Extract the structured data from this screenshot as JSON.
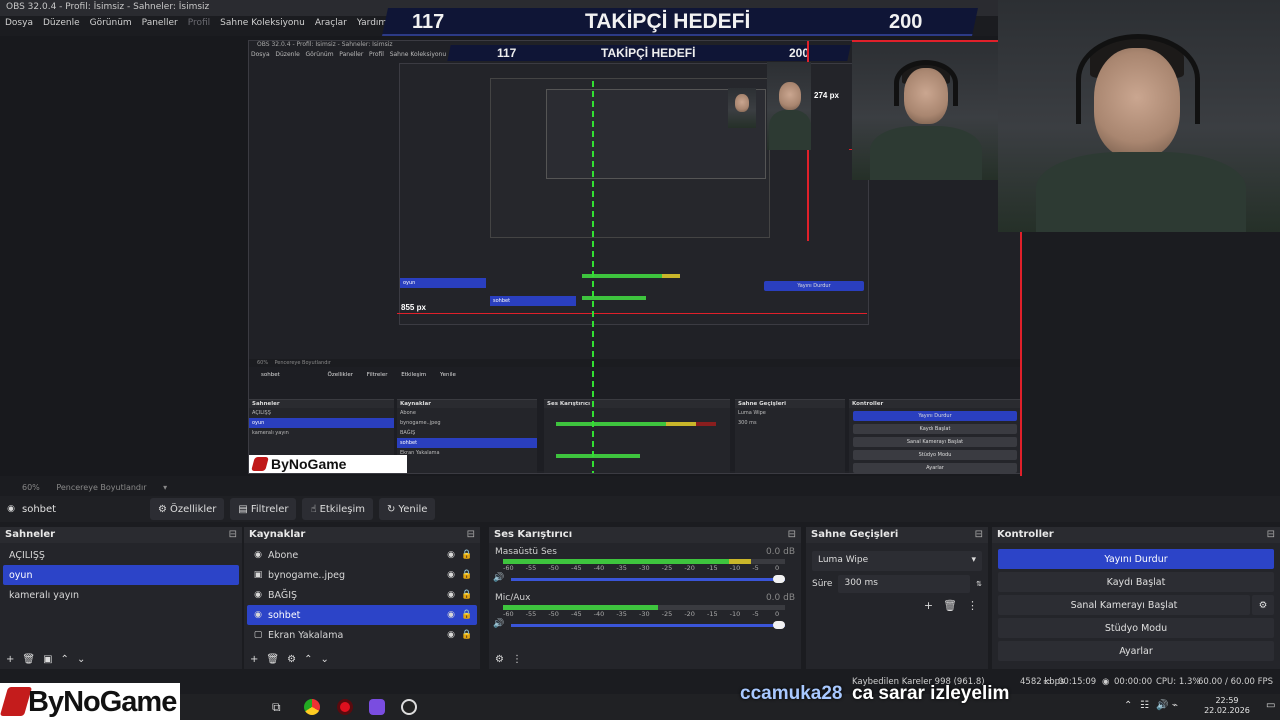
{
  "window": {
    "title": "OBS 32.0.4 - Profil: İsimsiz - Sahneler: İsimsiz"
  },
  "menu": [
    "Dosya",
    "Düzenle",
    "Görünüm",
    "Paneller",
    "Profil",
    "Sahne Koleksiyonu",
    "Araçlar",
    "Yardım"
  ],
  "goal_banner": {
    "current": "117",
    "title": "TAKİPÇİ HEDEFİ",
    "goal": "200"
  },
  "nested_preview": {
    "px_label_1": "274 px",
    "px_label_2": "855 px",
    "src_name": "sohbet",
    "btns": [
      "Özellikler",
      "Filtreler",
      "Etkileşim",
      "Yenile"
    ]
  },
  "zoom_bar": {
    "zoom": "60%",
    "fit_label": "Pencereye Boyutlandır"
  },
  "source_toolbar": {
    "source_name": "sohbet",
    "properties": "Özellikler",
    "filters": "Filtreler",
    "interact": "Etkileşim",
    "refresh": "Yenile"
  },
  "scenes": {
    "title": "Sahneler",
    "items": [
      "AÇILIŞŞ",
      "oyun",
      "kameralı yayın"
    ],
    "selected": "oyun"
  },
  "sources": {
    "title": "Kaynaklar",
    "items": [
      "Abone",
      "bynogame..jpeg",
      "BAĞIŞ",
      "sohbet",
      "Ekran Yakalama"
    ],
    "selected": "sohbet"
  },
  "mixer": {
    "title": "Ses Karıştırıcı",
    "channels": [
      {
        "name": "Masaüstü Ses",
        "db": "0.0 dB",
        "level": 0.88
      },
      {
        "name": "Mic/Aux",
        "db": "0.0 dB",
        "level": 0.55
      }
    ],
    "scale": [
      "-60",
      "-55",
      "-50",
      "-45",
      "-40",
      "-35",
      "-30",
      "-25",
      "-20",
      "-15",
      "-10",
      "-5",
      "0"
    ]
  },
  "transitions": {
    "title": "Sahne Geçişleri",
    "selected": "Luma Wipe",
    "duration_label": "Süre",
    "duration_value": "300 ms"
  },
  "controls": {
    "title": "Kontroller",
    "stop_stream": "Yayını Durdur",
    "start_record": "Kaydı Başlat",
    "virtual_cam": "Sanal Kamerayı Başlat",
    "studio_mode": "Stüdyo Modu",
    "settings": "Ayarlar"
  },
  "status": {
    "dropped": "Kaybedilen Kareler 998 (961.8)",
    "bitrate": "4582 kbps",
    "stream_time": "00:15:09",
    "rec_time": "00:00:00",
    "cpu": "CPU: 1.3%",
    "fps": "60.00 / 60.00 FPS"
  },
  "overlay": {
    "logo": "ByNoGame",
    "chat_user": "ccamuka28",
    "chat_msg": "ca sarar izleyelim"
  },
  "taskbar": {
    "time": "22:59",
    "date": "22.02.2026"
  },
  "colors": {
    "accent": "#2c44c8",
    "meter_green": "#3ec43e",
    "meter_yellow": "#c9b62a",
    "meter_red": "#8a1e1e",
    "guide_red": "#e0202a"
  }
}
